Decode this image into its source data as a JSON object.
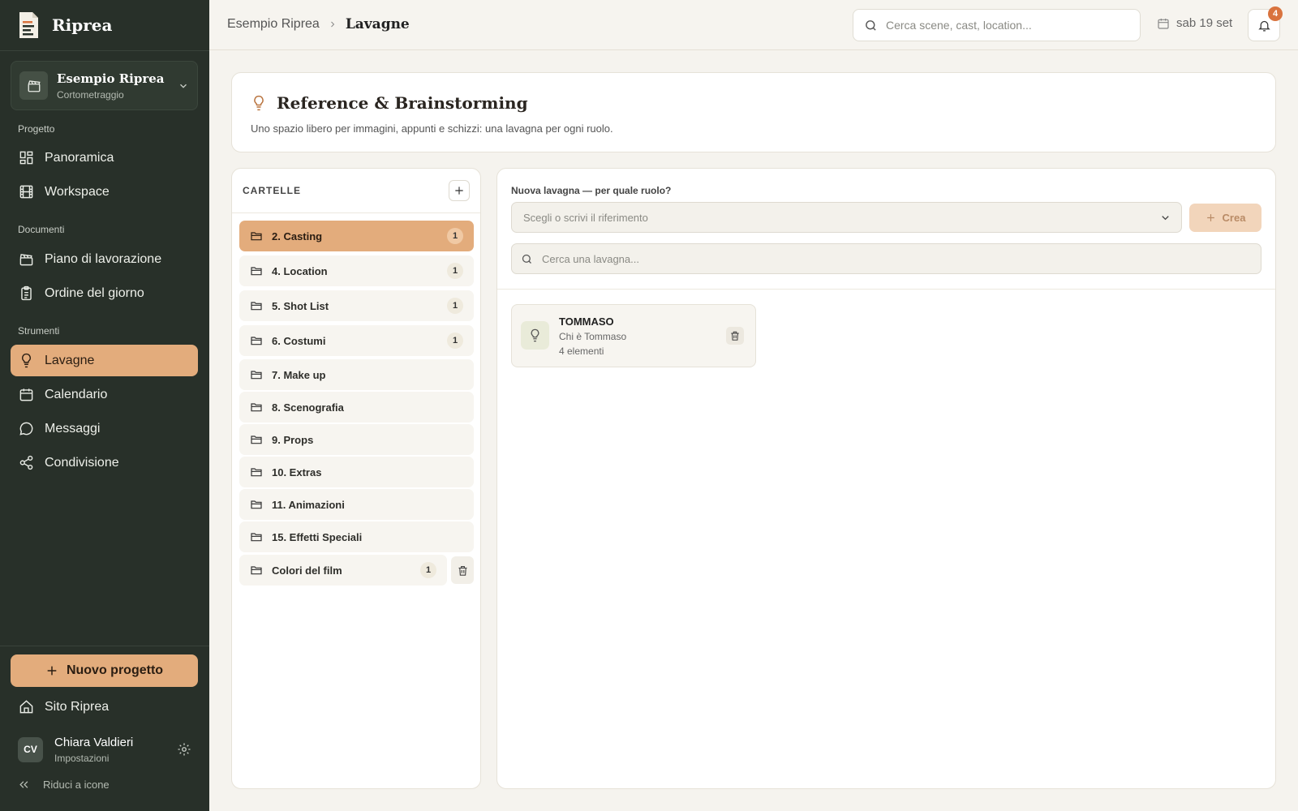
{
  "colors": {
    "sidebar_bg": "#283029",
    "accent": "#e3ac7c",
    "badge": "#d9733e",
    "page_bg": "#f5f3ee"
  },
  "app": {
    "name": "Riprea"
  },
  "project": {
    "name": "Esempio Riprea",
    "type": "Cortometraggio"
  },
  "sidebar": {
    "sections": [
      {
        "label": "Progetto",
        "items": [
          {
            "label": "Panoramica",
            "icon": "grid-icon"
          },
          {
            "label": "Workspace",
            "icon": "film-icon"
          }
        ]
      },
      {
        "label": "Documenti",
        "items": [
          {
            "label": "Piano di lavorazione",
            "icon": "clapperboard-icon"
          },
          {
            "label": "Ordine del giorno",
            "icon": "clipboard-icon"
          }
        ]
      },
      {
        "label": "Strumenti",
        "items": [
          {
            "label": "Lavagne",
            "icon": "lightbulb-icon",
            "active": true
          },
          {
            "label": "Calendario",
            "icon": "calendar-icon"
          },
          {
            "label": "Messaggi",
            "icon": "message-icon"
          },
          {
            "label": "Condivisione",
            "icon": "share-icon"
          }
        ]
      }
    ],
    "new_project": "Nuovo progetto",
    "site_link": "Sito Riprea",
    "user": {
      "initials": "CV",
      "name": "Chiara Valdieri",
      "subtitle": "Impostazioni"
    },
    "collapse": "Riduci a icone"
  },
  "topbar": {
    "breadcrumb": [
      "Esempio Riprea",
      "Lavagne"
    ],
    "search_placeholder": "Cerca scene, cast, location...",
    "date": "sab 19 set",
    "notifications": "4"
  },
  "header": {
    "title": "Reference & Brainstorming",
    "description": "Uno spazio libero per immagini, appunti e schizzi: una lavagna per ogni ruolo."
  },
  "folders": {
    "heading": "CARTELLE",
    "items": [
      {
        "label": "2. Casting",
        "count": "1",
        "active": true
      },
      {
        "label": "4. Location",
        "count": "1"
      },
      {
        "label": "5. Shot List",
        "count": "1"
      },
      {
        "label": "6. Costumi",
        "count": "1"
      },
      {
        "label": "7. Make up"
      },
      {
        "label": "8. Scenografia"
      },
      {
        "label": "9. Props"
      },
      {
        "label": "10. Extras"
      },
      {
        "label": "11. Animazioni"
      },
      {
        "label": "15. Effetti Speciali"
      },
      {
        "label": "Colori del film",
        "count": "1",
        "deletable": true
      }
    ]
  },
  "boards": {
    "new_label": "Nuova lavagna — per quale ruolo?",
    "select_placeholder": "Scegli o scrivi il riferimento",
    "create_label": "Crea",
    "search_placeholder": "Cerca una lavagna...",
    "items": [
      {
        "name": "TOMMASO",
        "subtitle": "Chi è Tommaso",
        "count": "4 elementi"
      }
    ]
  }
}
